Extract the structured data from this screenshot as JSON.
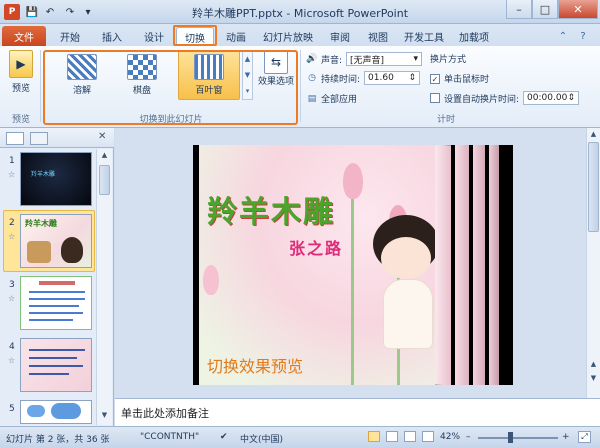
{
  "window": {
    "title": "羚羊木雕PPT.pptx - Microsoft PowerPoint",
    "minimize": "–",
    "maximize": "□",
    "close": "✕"
  },
  "quick_access": {
    "save_icon": "💾",
    "undo_icon": "↶",
    "redo_icon": "↷",
    "customize_icon": "▾",
    "app_letter": "P"
  },
  "tabs": {
    "file": "文件",
    "items": [
      "开始",
      "插入",
      "设计",
      "切换",
      "动画",
      "幻灯片放映",
      "审阅",
      "视图",
      "开发工具",
      "加载项"
    ],
    "active": "切换"
  },
  "ribbon": {
    "preview": {
      "label": "预览",
      "group": "预览"
    },
    "transitions": {
      "items": [
        "溶解",
        "棋盘",
        "百叶窗"
      ],
      "selected": "百叶窗",
      "effect_options": "效果选项",
      "group": "切换到此幻灯片"
    },
    "timing": {
      "sound_label": "声音:",
      "sound_value": "[无声音]",
      "duration_label": "持续时间:",
      "duration_value": "01.60",
      "apply_all": "全部应用",
      "advance_title": "换片方式",
      "on_click": "单击鼠标时",
      "on_click_checked": true,
      "after_label": "设置自动换片时间:",
      "after_value": "00:00.00",
      "group": "计时"
    }
  },
  "slides_panel": {
    "slides": [
      {
        "num": "1",
        "title": "羚羊木雕"
      },
      {
        "num": "2",
        "title": "羚羊木雕"
      },
      {
        "num": "3",
        "title": ""
      },
      {
        "num": "4",
        "title": ""
      },
      {
        "num": "5",
        "title": ""
      }
    ],
    "selected": 2,
    "star": "☆"
  },
  "slide": {
    "title": "羚羊木雕",
    "author": "张之路",
    "caption": "切换效果预览"
  },
  "notes": {
    "placeholder": "单击此处添加备注"
  },
  "status": {
    "slide_info": "幻灯片 第 2 张，共 36 张",
    "theme": "\"CCONTNTH\"",
    "language": "中文(中国)",
    "zoom": "42%",
    "minus": "–",
    "plus": "+"
  },
  "colors": {
    "accent": "#ee7a24",
    "file_tab": "#c74620",
    "selected_thumb": "#ffe59a"
  }
}
